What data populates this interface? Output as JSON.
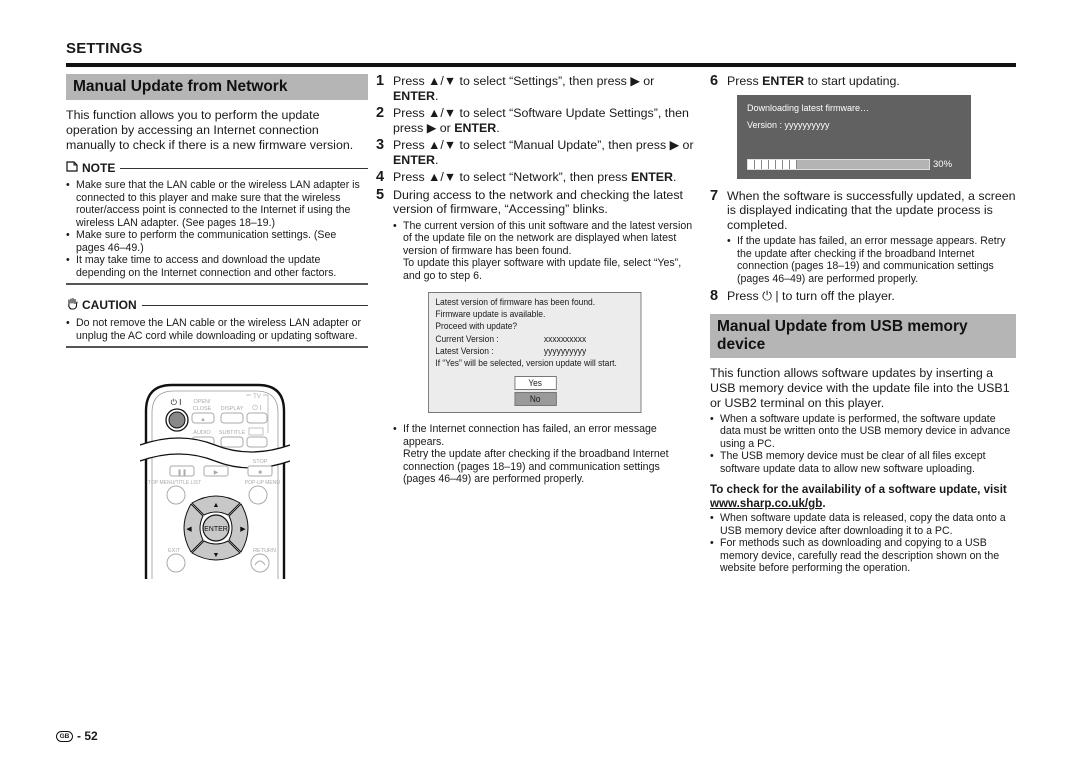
{
  "page": {
    "section_label": "SETTINGS",
    "page_number": "52",
    "region_badge": "GB"
  },
  "left": {
    "heading": "Manual Update from Network",
    "intro": "This function allows you to perform the update operation by accessing an Internet connection manually to check if there is a new firmware version.",
    "note": {
      "icon": "note-icon",
      "label": "NOTE",
      "items": [
        "Make sure that the LAN cable or the wireless LAN adapter is connected to this player and make sure that the wireless router/access point is connected to the Internet if using the wireless LAN adapter. (See pages 18–19.)",
        "Make sure to perform the communication settings. (See pages 46–49.)",
        "It may take time to access and download the update depending on the Internet connection and other factors."
      ]
    },
    "caution": {
      "icon": "caution-hand-icon",
      "label": "CAUTION",
      "items": [
        "Do not remove the LAN cable or the wireless LAN adapter or unplug the AC cord while downloading or updating software."
      ]
    },
    "remote": {
      "power_label": "⏻ I",
      "open_close": "OPEN/ CLOSE",
      "display": "DISPLAY",
      "tv": "TV",
      "tv_power": "⏻ I",
      "audio": "AUDIO",
      "subtitle": "SUBTITLE",
      "stop": "STOP",
      "top_menu": "TOP MENU/TITLE LIST",
      "popup_menu": "POP-UP MENU",
      "enter": "ENTER",
      "exit": "EXIT",
      "return": "RETURN"
    }
  },
  "middle": {
    "steps": [
      {
        "num": "1",
        "pre": "Press ▲/▼ to select “Settings”, then press ▶ or ",
        "bold": "ENTER",
        "post": "."
      },
      {
        "num": "2",
        "pre": "Press ▲/▼ to select “Software Update Settings”, then press ▶ or ",
        "bold": "ENTER",
        "post": "."
      },
      {
        "num": "3",
        "pre": "Press ▲/▼ to select “Manual Update”, then press ▶ or ",
        "bold": "ENTER",
        "post": "."
      },
      {
        "num": "4",
        "pre": "Press ▲/▼ to select “Network”, then press ",
        "bold": "ENTER",
        "post": "."
      },
      {
        "num": "5",
        "text": "During access to the network and checking the latest version of firmware, “Accessing” blinks."
      }
    ],
    "step5_bullet": "The current version of this unit software and the latest version of the update file on the network are displayed when latest version of firmware has been found.",
    "step5_extra": "To update this player software with update file, select “Yes”, and go to step 6.",
    "dialog": {
      "line1": "Latest version of firmware has been found.",
      "line2": "Firmware update is available.",
      "line3": "Proceed with update?",
      "current_label": "Current Version :",
      "current_value": "xxxxxxxxxx",
      "latest_label": "Latest Version  :",
      "latest_value": "yyyyyyyyyy",
      "line_note": "If “Yes” will be selected, version update will start.",
      "yes": "Yes",
      "no": "No"
    },
    "fail_bullet": "If the Internet connection has failed, an error message appears.",
    "fail_extra": "Retry the update after checking if the broadband Internet connection (pages 18–19) and communication settings (pages 46–49) are performed properly."
  },
  "right": {
    "step6": {
      "num": "6",
      "pre": "Press ",
      "bold": "ENTER",
      "post": " to start updating."
    },
    "download": {
      "title": "Downloading latest firmware…",
      "version_label": "Version :",
      "version_value": "yyyyyyyyyy",
      "progress_percent": 30,
      "progress_label": "30%"
    },
    "step7": {
      "num": "7",
      "text": "When the software is successfully updated, a screen is displayed indicating that the update process is completed."
    },
    "step7_bullet": "If the update has failed, an error message appears. Retry the update after checking if the broadband Internet connection (pages 18–19) and communication settings (pages 46–49) are performed properly.",
    "step8": {
      "num": "8",
      "pre": "Press ",
      "icon": "⏻",
      "post": " | to turn off the player."
    },
    "usb_heading": "Manual Update from USB memory device",
    "usb_intro": "This function allows software updates by inserting a USB memory device with the update file into the USB1 or USB2 terminal on this player.",
    "usb_items": [
      "When a software update is performed, the software update data must be written onto the USB memory device in advance using a PC.",
      "The USB memory device must be clear of all files except software update data to allow new software uploading."
    ],
    "check_pre": "To check for the availability of a software update, visit ",
    "check_link": "www.sharp.co.uk/gb",
    "check_post": ".",
    "check_items": [
      "When software update data is released, copy the data onto a USB memory device after downloading it to a PC.",
      "For methods such as downloading and copying to a USB memory device, carefully read the description shown on the website before performing the operation."
    ]
  }
}
